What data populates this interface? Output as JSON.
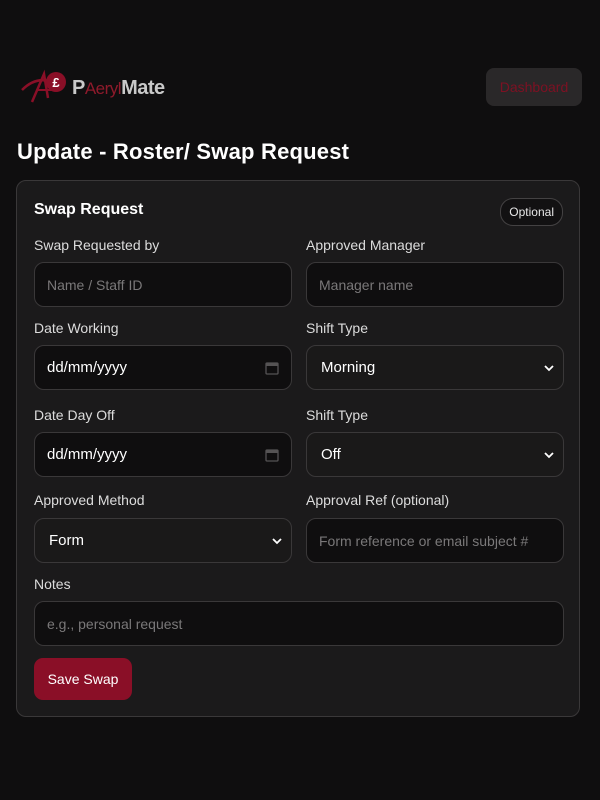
{
  "header": {
    "logo": {
      "mark_text": "£",
      "text_part1": "P",
      "text_part2": "Aeryl",
      "text_part3": "Mate",
      "icon": "currency-logo-icon"
    },
    "dashboard_label": "Dashboard"
  },
  "page": {
    "title": "Update - Roster/ Swap Request"
  },
  "form": {
    "card_title": "Swap Request",
    "badge": "Optional",
    "swap_requested_by": {
      "label": "Swap Requested by",
      "placeholder": "Name / Staff ID"
    },
    "approved_manager": {
      "label": "Approved Manager",
      "placeholder": "Manager name"
    },
    "date_working": {
      "label": "Date Working",
      "value": "dd/mm/yyyy",
      "icon": "calendar-icon"
    },
    "shift_type_working": {
      "label": "Shift Type",
      "value": "Morning",
      "icon": "chevron-down-icon"
    },
    "date_day_off": {
      "label": "Date Day Off",
      "value": "dd/mm/yyyy",
      "icon": "calendar-icon"
    },
    "shift_type_off": {
      "label": "Shift Type",
      "value": "Off",
      "icon": "chevron-down-icon"
    },
    "approved_method": {
      "label": "Approved Method",
      "value": "Form",
      "icon": "chevron-down-icon"
    },
    "approval_ref": {
      "label": "Approval Ref (optional)",
      "placeholder": "Form reference or email subject #"
    },
    "notes": {
      "label": "Notes",
      "placeholder": "e.g., personal request"
    },
    "save_label": "Save Swap"
  },
  "colors": {
    "background": "#0f0e0f",
    "card": "#1b1a1b",
    "accent": "#8a0f27",
    "dashboard_text": "#7d1123"
  }
}
